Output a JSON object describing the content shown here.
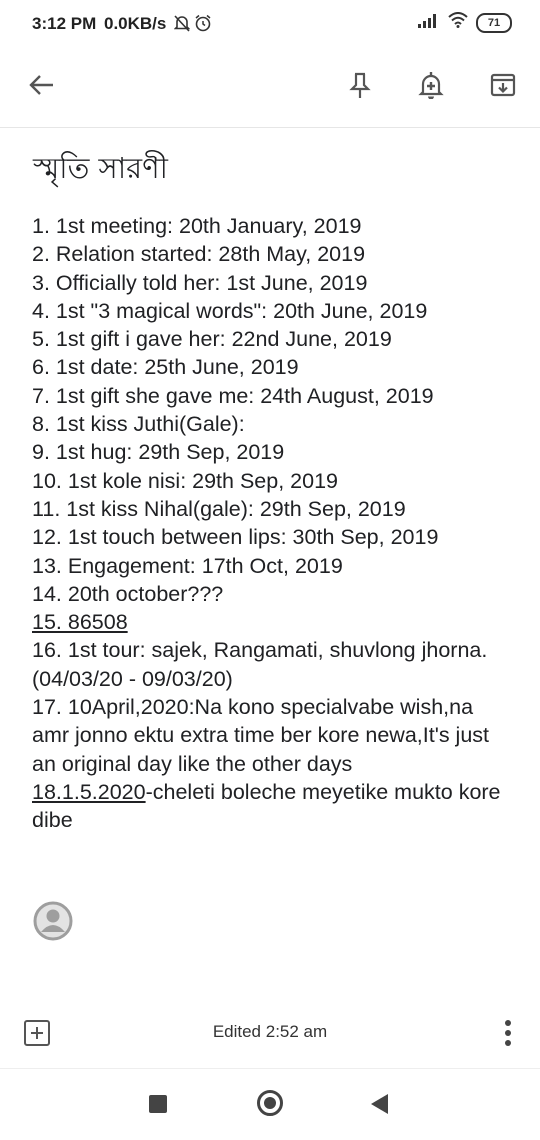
{
  "status_bar": {
    "time": "3:12 PM",
    "network_speed": "0.0KB/s",
    "battery": "71",
    "icons": [
      "mute-icon",
      "alarm-icon",
      "signal-icon",
      "wifi-icon"
    ]
  },
  "toolbar": {
    "icons": [
      "back-arrow-icon",
      "pin-icon",
      "reminder-bell-icon",
      "archive-icon"
    ]
  },
  "note": {
    "title": "স্মৃতি সারণী",
    "lines": [
      "1.  1st meeting: 20th January, 2019",
      "2. Relation started: 28th May, 2019",
      "3. Officially told her: 1st June, 2019",
      "4. 1st \"3 magical words\": 20th June, 2019",
      "5. 1st gift i gave her: 22nd June, 2019",
      "6. 1st date: 25th June, 2019",
      "7. 1st gift she gave me: 24th August, 2019",
      "8. 1st kiss Juthi(Gale):",
      "9. 1st hug: 29th Sep, 2019",
      "10. 1st kole nisi: 29th Sep, 2019",
      "11. 1st kiss Nihal(gale): 29th Sep, 2019",
      "12. 1st touch between lips: 30th Sep, 2019",
      "13. Engagement: 17th Oct, 2019",
      "14. 20th october???",
      "15. 86508",
      "16. 1st tour: sajek, Rangamati, shuvlong jhorna. (04/03/20 - 09/03/20)",
      "17. 10April,2020:Na kono specialvabe wish,na amr jonno ektu extra time ber kore newa,It's just an original day like the other days"
    ],
    "line18_link": "18.1.5.2020",
    "line18_rest": "-cheleti boleche meyetike mukto kore dibe"
  },
  "bottom_bar": {
    "edited": "Edited 2:52 am"
  },
  "colors": {
    "icon": "#555555",
    "text": "#202124"
  }
}
